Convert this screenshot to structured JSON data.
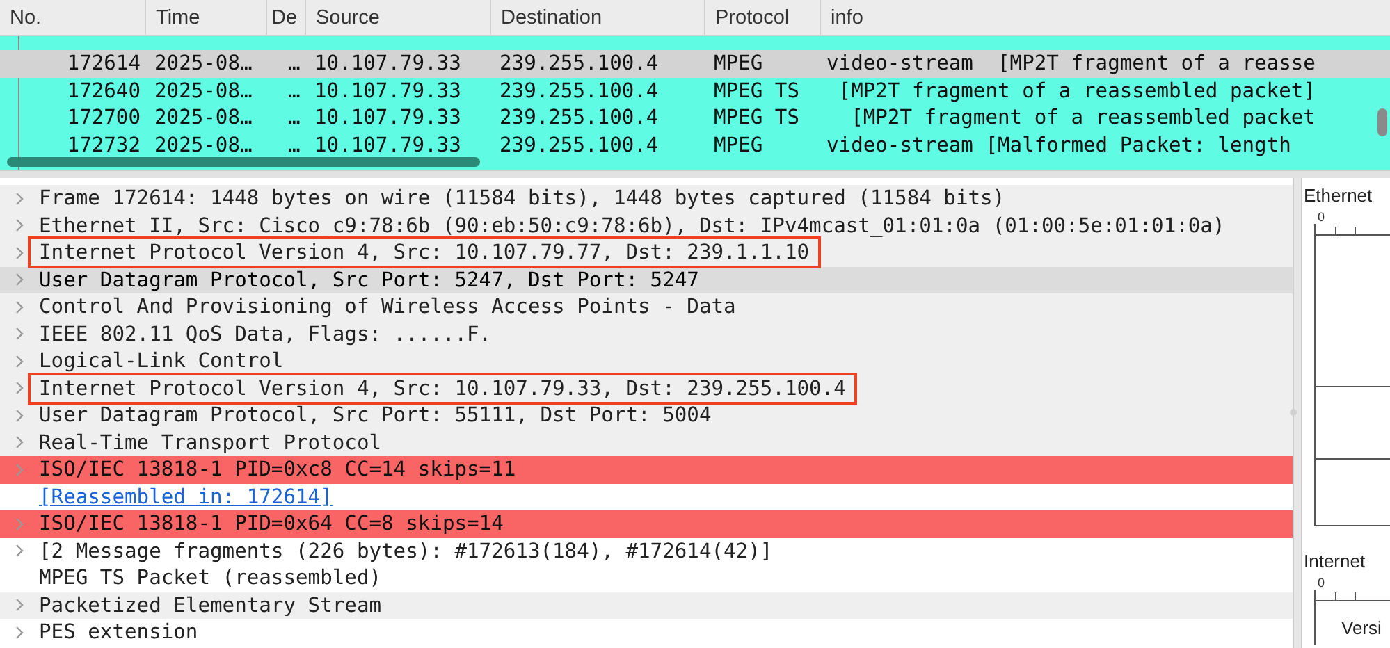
{
  "packet_list": {
    "columns": [
      "No.",
      "Time",
      "De",
      "Source",
      "Destination",
      "Protocol",
      "info"
    ],
    "rows": [
      {
        "no": "172614",
        "time": "2025-08…",
        "delta": "…",
        "source": "10.107.79.33",
        "destination": "239.255.100.4",
        "protocol": "MPEG",
        "info": "video-stream  [MP2T fragment of a reasse",
        "selected": true
      },
      {
        "no": "172640",
        "time": "2025-08…",
        "delta": "…",
        "source": "10.107.79.33",
        "destination": "239.255.100.4",
        "protocol": "MPEG TS",
        "info": " [MP2T fragment of a reassembled packet]",
        "selected": false
      },
      {
        "no": "172700",
        "time": "2025-08…",
        "delta": "…",
        "source": "10.107.79.33",
        "destination": "239.255.100.4",
        "protocol": "MPEG TS",
        "info": "  [MP2T fragment of a reassembled packet",
        "selected": false
      },
      {
        "no": "172732",
        "time": "2025-08…",
        "delta": "…",
        "source": "10.107.79.33",
        "destination": "239.255.100.4",
        "protocol": "MPEG",
        "info": "video-stream [Malformed Packet: length",
        "selected": false
      }
    ]
  },
  "detail_tree": {
    "items": [
      {
        "text": "Frame 172614: 1448 bytes on wire (11584 bits), 1448 bytes captured (11584 bits)",
        "kind": "normal",
        "expandable": true,
        "shaded": true,
        "selected": false,
        "outlined": false
      },
      {
        "text": "Ethernet II, Src: Cisco_c9:78:6b (90:eb:50:c9:78:6b), Dst: IPv4mcast_01:01:0a (01:00:5e:01:01:0a)",
        "kind": "normal",
        "expandable": true,
        "shaded": true,
        "selected": false,
        "outlined": false
      },
      {
        "text": "Internet Protocol Version 4, Src: 10.107.79.77, Dst: 239.1.1.10",
        "kind": "normal",
        "expandable": true,
        "shaded": true,
        "selected": false,
        "outlined": true
      },
      {
        "text": "User Datagram Protocol, Src Port: 5247, Dst Port: 5247",
        "kind": "normal",
        "expandable": true,
        "shaded": true,
        "selected": true,
        "outlined": false
      },
      {
        "text": "Control And Provisioning of Wireless Access Points - Data",
        "kind": "normal",
        "expandable": true,
        "shaded": true,
        "selected": false,
        "outlined": false
      },
      {
        "text": "IEEE 802.11 QoS Data, Flags: ......F.",
        "kind": "normal",
        "expandable": true,
        "shaded": true,
        "selected": false,
        "outlined": false
      },
      {
        "text": "Logical-Link Control",
        "kind": "normal",
        "expandable": true,
        "shaded": true,
        "selected": false,
        "outlined": false
      },
      {
        "text": "Internet Protocol Version 4, Src: 10.107.79.33, Dst: 239.255.100.4",
        "kind": "normal",
        "expandable": true,
        "shaded": true,
        "selected": false,
        "outlined": true
      },
      {
        "text": "User Datagram Protocol, Src Port: 55111, Dst Port: 5004",
        "kind": "normal",
        "expandable": true,
        "shaded": true,
        "selected": false,
        "outlined": false
      },
      {
        "text": "Real-Time Transport Protocol",
        "kind": "normal",
        "expandable": true,
        "shaded": true,
        "selected": false,
        "outlined": false
      },
      {
        "text": "ISO/IEC 13818-1 PID=0xc8 CC=14 skips=11",
        "kind": "error",
        "expandable": true,
        "shaded": false,
        "selected": false,
        "outlined": false
      },
      {
        "text": "[Reassembled in: 172614]",
        "kind": "link",
        "expandable": false,
        "shaded": false,
        "selected": false,
        "outlined": false
      },
      {
        "text": "ISO/IEC 13818-1 PID=0x64 CC=8 skips=14",
        "kind": "error",
        "expandable": true,
        "shaded": false,
        "selected": false,
        "outlined": false
      },
      {
        "text": "[2 Message fragments (226 bytes): #172613(184), #172614(42)]",
        "kind": "normal",
        "expandable": true,
        "shaded": false,
        "selected": false,
        "outlined": false
      },
      {
        "text": "MPEG TS Packet (reassembled)",
        "kind": "normal",
        "expandable": false,
        "shaded": false,
        "selected": false,
        "outlined": false
      },
      {
        "text": "Packetized Elementary Stream",
        "kind": "normal",
        "expandable": true,
        "shaded": true,
        "selected": false,
        "outlined": false
      },
      {
        "text": "PES extension",
        "kind": "normal",
        "expandable": true,
        "shaded": false,
        "selected": false,
        "outlined": false
      }
    ]
  },
  "diagram_pane": {
    "sections": [
      {
        "title": "Ethernet",
        "tick": "0"
      },
      {
        "title": "Internet",
        "tick": "0",
        "field": "Versi"
      }
    ]
  }
}
